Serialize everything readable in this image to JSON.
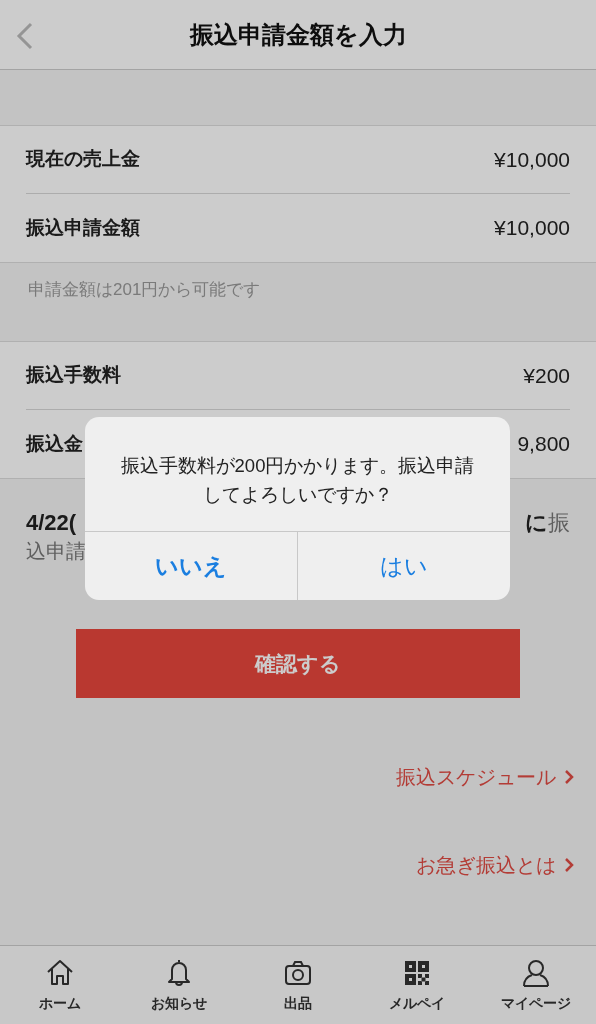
{
  "header": {
    "title": "振込申請金額を入力"
  },
  "amount_rows": [
    {
      "label": "現在の売上金",
      "value": "¥10,000"
    },
    {
      "label": "振込申請金額",
      "value": "¥10,000"
    }
  ],
  "note": "申請金額は201円から可能です",
  "fee_rows": [
    {
      "label": "振込手数料",
      "value": "¥200"
    },
    {
      "label": "振込金",
      "value": "9,800"
    }
  ],
  "info": {
    "line_1_start": "4/22(",
    "line_1_end_bold": "に",
    "line_1_end": "振",
    "line_2": "込申請"
  },
  "confirm_button": "確認する",
  "links": [
    "振込スケジュール",
    "お急ぎ振込とは"
  ],
  "tabs": [
    {
      "kind": "home",
      "label": "ホーム"
    },
    {
      "kind": "bell",
      "label": "お知らせ"
    },
    {
      "kind": "camera",
      "label": "出品"
    },
    {
      "kind": "qr",
      "label": "メルペイ"
    },
    {
      "kind": "person",
      "label": "マイページ"
    }
  ],
  "dialog": {
    "message": "振込手数料が200円かかります。振込申請してよろしいですか？",
    "buttons": [
      {
        "label": "いいえ",
        "emphasized": true
      },
      {
        "label": "はい",
        "emphasized": false
      }
    ]
  }
}
